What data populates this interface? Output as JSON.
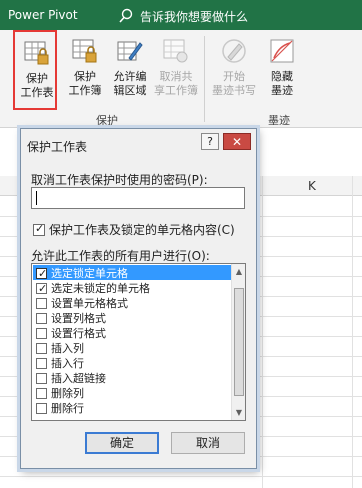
{
  "titlebar": {
    "power_pivot": "Power Pivot",
    "tell_me": "告诉我你想要做什么"
  },
  "ribbon": {
    "protect_group": {
      "label": "保护",
      "buttons": [
        {
          "label_line1": "保护",
          "label_line2": "工作表",
          "icon": "protect-sheet-icon",
          "enabled": true,
          "highlighted": true
        },
        {
          "label_line1": "保护",
          "label_line2": "工作簿",
          "icon": "protect-workbook-icon",
          "enabled": true
        },
        {
          "label_line1": "允许编",
          "label_line2": "辑区域",
          "icon": "allow-edit-ranges-icon",
          "enabled": true
        },
        {
          "label_line1": "取消共",
          "label_line2": "享工作簿",
          "icon": "unshare-workbook-icon",
          "enabled": false
        }
      ]
    },
    "ink_group": {
      "label": "墨迹",
      "buttons": [
        {
          "label_line1": "开始",
          "label_line2": "墨迹书写",
          "icon": "start-inking-icon",
          "enabled": false
        },
        {
          "label_line1": "隐藏",
          "label_line2": "墨迹",
          "icon": "hide-ink-icon",
          "enabled": true
        }
      ]
    }
  },
  "sheet": {
    "visible_column": "K"
  },
  "dialog": {
    "title": "保护工作表",
    "help": "?",
    "close": "✕",
    "password_label": "取消工作表保护时使用的密码(P):",
    "password_value": "",
    "protect_checkbox_label": "保护工作表及锁定的单元格内容(C)",
    "protect_checked": true,
    "allow_label": "允许此工作表的所有用户进行(O):",
    "permissions": [
      {
        "label": "选定锁定单元格",
        "checked": true,
        "selected": true
      },
      {
        "label": "选定未锁定的单元格",
        "checked": true,
        "selected": false
      },
      {
        "label": "设置单元格格式",
        "checked": false,
        "selected": false
      },
      {
        "label": "设置列格式",
        "checked": false,
        "selected": false
      },
      {
        "label": "设置行格式",
        "checked": false,
        "selected": false
      },
      {
        "label": "插入列",
        "checked": false,
        "selected": false
      },
      {
        "label": "插入行",
        "checked": false,
        "selected": false
      },
      {
        "label": "插入超链接",
        "checked": false,
        "selected": false
      },
      {
        "label": "删除列",
        "checked": false,
        "selected": false
      },
      {
        "label": "删除行",
        "checked": false,
        "selected": false
      }
    ],
    "ok_label": "确定",
    "cancel_label": "取消"
  },
  "colors": {
    "excel_green": "#217346",
    "highlight_red": "#e53935",
    "selection_blue": "#3399ff"
  }
}
